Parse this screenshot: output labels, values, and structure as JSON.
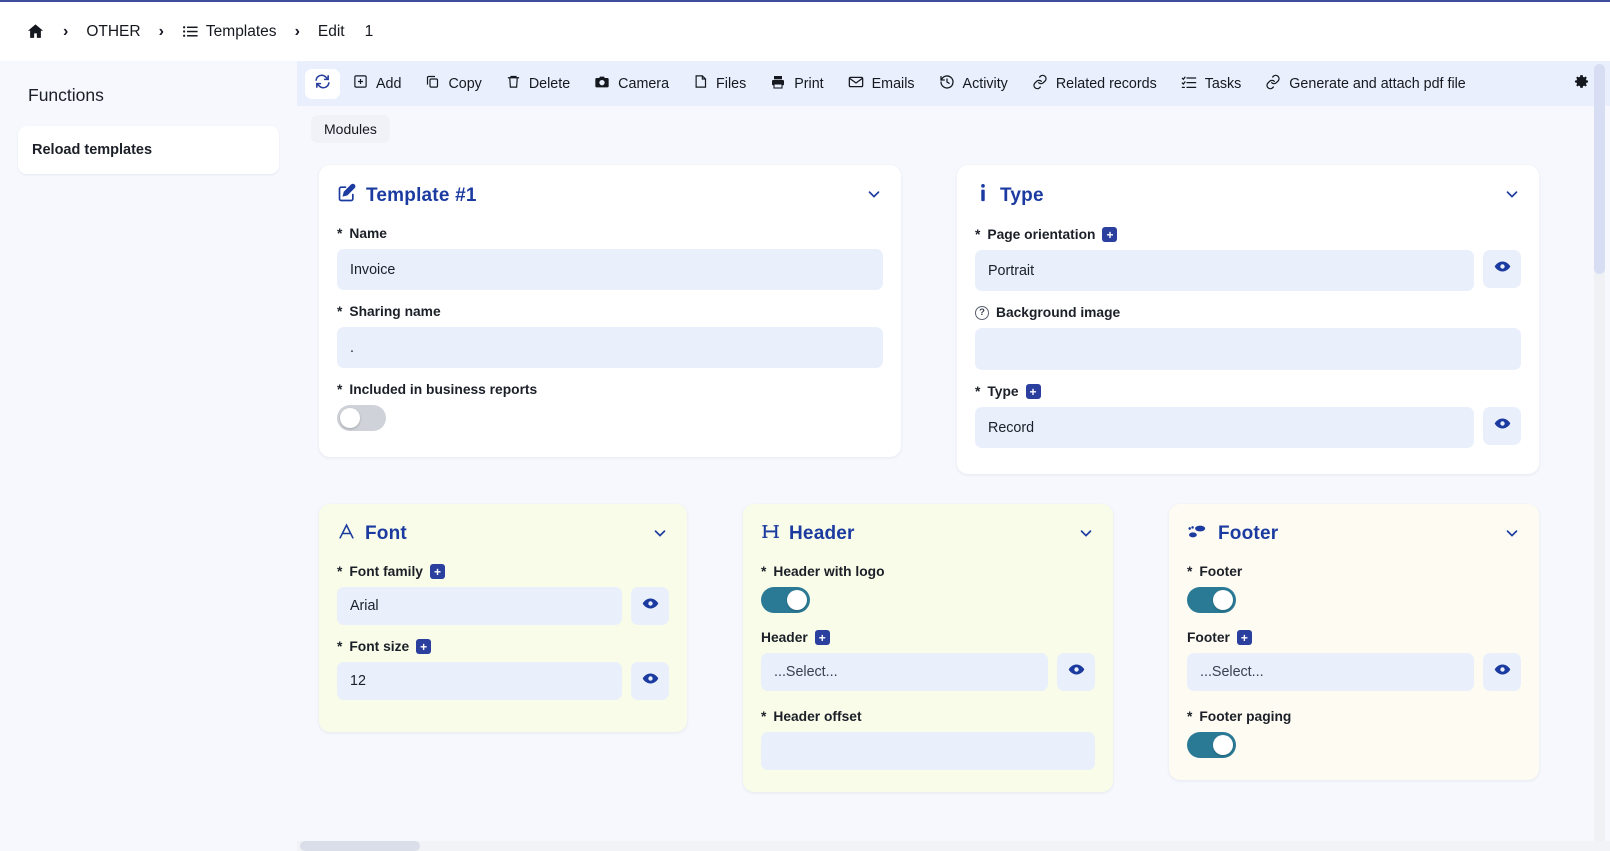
{
  "breadcrumb": {
    "home_icon": "home-icon",
    "items": [
      {
        "label": "OTHER",
        "icon": null
      },
      {
        "label": "Templates",
        "icon": "list-icon"
      },
      {
        "label": "Edit",
        "icon": null
      }
    ],
    "record_id": "1",
    "separator": "›"
  },
  "functions_panel": {
    "title": "Functions",
    "items": [
      {
        "label": "Reload templates"
      }
    ]
  },
  "toolbar": {
    "refresh_label": "",
    "buttons": [
      {
        "label": "Add",
        "icon": "plus-square-icon"
      },
      {
        "label": "Copy",
        "icon": "copy-icon"
      },
      {
        "label": "Delete",
        "icon": "trash-icon"
      },
      {
        "label": "Camera",
        "icon": "camera-icon"
      },
      {
        "label": "Files",
        "icon": "file-icon"
      },
      {
        "label": "Print",
        "icon": "printer-icon"
      },
      {
        "label": "Emails",
        "icon": "envelope-icon"
      },
      {
        "label": "Activity",
        "icon": "history-icon"
      },
      {
        "label": "Related records",
        "icon": "link-icon"
      },
      {
        "label": "Tasks",
        "icon": "task-list-icon"
      },
      {
        "label": "Generate and attach pdf file",
        "icon": "link-icon"
      }
    ],
    "settings_icon": "gear-icon"
  },
  "modules_tab": {
    "label": "Modules"
  },
  "cards": {
    "template": {
      "title": "Template #1",
      "icon": "edit-pencil-icon",
      "fields": {
        "name": {
          "label": "Name",
          "required": "*",
          "value": "Invoice"
        },
        "sharing_name": {
          "label": "Sharing name",
          "required": "*",
          "value": "."
        },
        "included_in_reports": {
          "label": "Included in business reports",
          "required": "*",
          "state": "off"
        }
      }
    },
    "type": {
      "title": "Type",
      "icon": "info-i-icon",
      "fields": {
        "page_orientation": {
          "label": "Page orientation",
          "required": "*",
          "value": "Portrait",
          "has_plus": true,
          "has_eye": true
        },
        "background_image": {
          "label": "Background image",
          "required": "",
          "value": "",
          "has_help": true
        },
        "type": {
          "label": "Type",
          "required": "*",
          "value": "Record",
          "has_plus": true,
          "has_eye": true
        }
      }
    },
    "font": {
      "title": "Font",
      "icon": "letter-a-icon",
      "fields": {
        "font_family": {
          "label": "Font family",
          "required": "*",
          "value": "Arial",
          "has_plus": true,
          "has_eye": true
        },
        "font_size": {
          "label": "Font size",
          "required": "*",
          "value": "12",
          "has_plus": true,
          "has_eye": true
        }
      }
    },
    "header": {
      "title": "Header",
      "icon": "letter-h-icon",
      "fields": {
        "header_with_logo": {
          "label": "Header with logo",
          "required": "*",
          "state": "on"
        },
        "header": {
          "label": "Header",
          "required": "",
          "value": "...Select...",
          "has_plus": true,
          "has_eye": true
        },
        "header_offset": {
          "label": "Header offset",
          "required": "*"
        }
      }
    },
    "footer": {
      "title": "Footer",
      "icon": "footprints-icon",
      "fields": {
        "footer_toggle": {
          "label": "Footer",
          "required": "*",
          "state": "on"
        },
        "footer": {
          "label": "Footer",
          "required": "",
          "value": "...Select...",
          "has_plus": true,
          "has_eye": true
        },
        "footer_paging": {
          "label": "Footer paging",
          "required": "*"
        }
      }
    }
  },
  "colors": {
    "accent_blue": "#1b3ba0",
    "toolbar_bg": "#e9effc",
    "page_bg": "#f6f8fd",
    "input_bg": "#e9effb",
    "card_lime": "#f8fce8",
    "card_cream": "#fefbf2",
    "toggle_on": "#2a7a96",
    "toggle_off": "#cfd2d8"
  }
}
